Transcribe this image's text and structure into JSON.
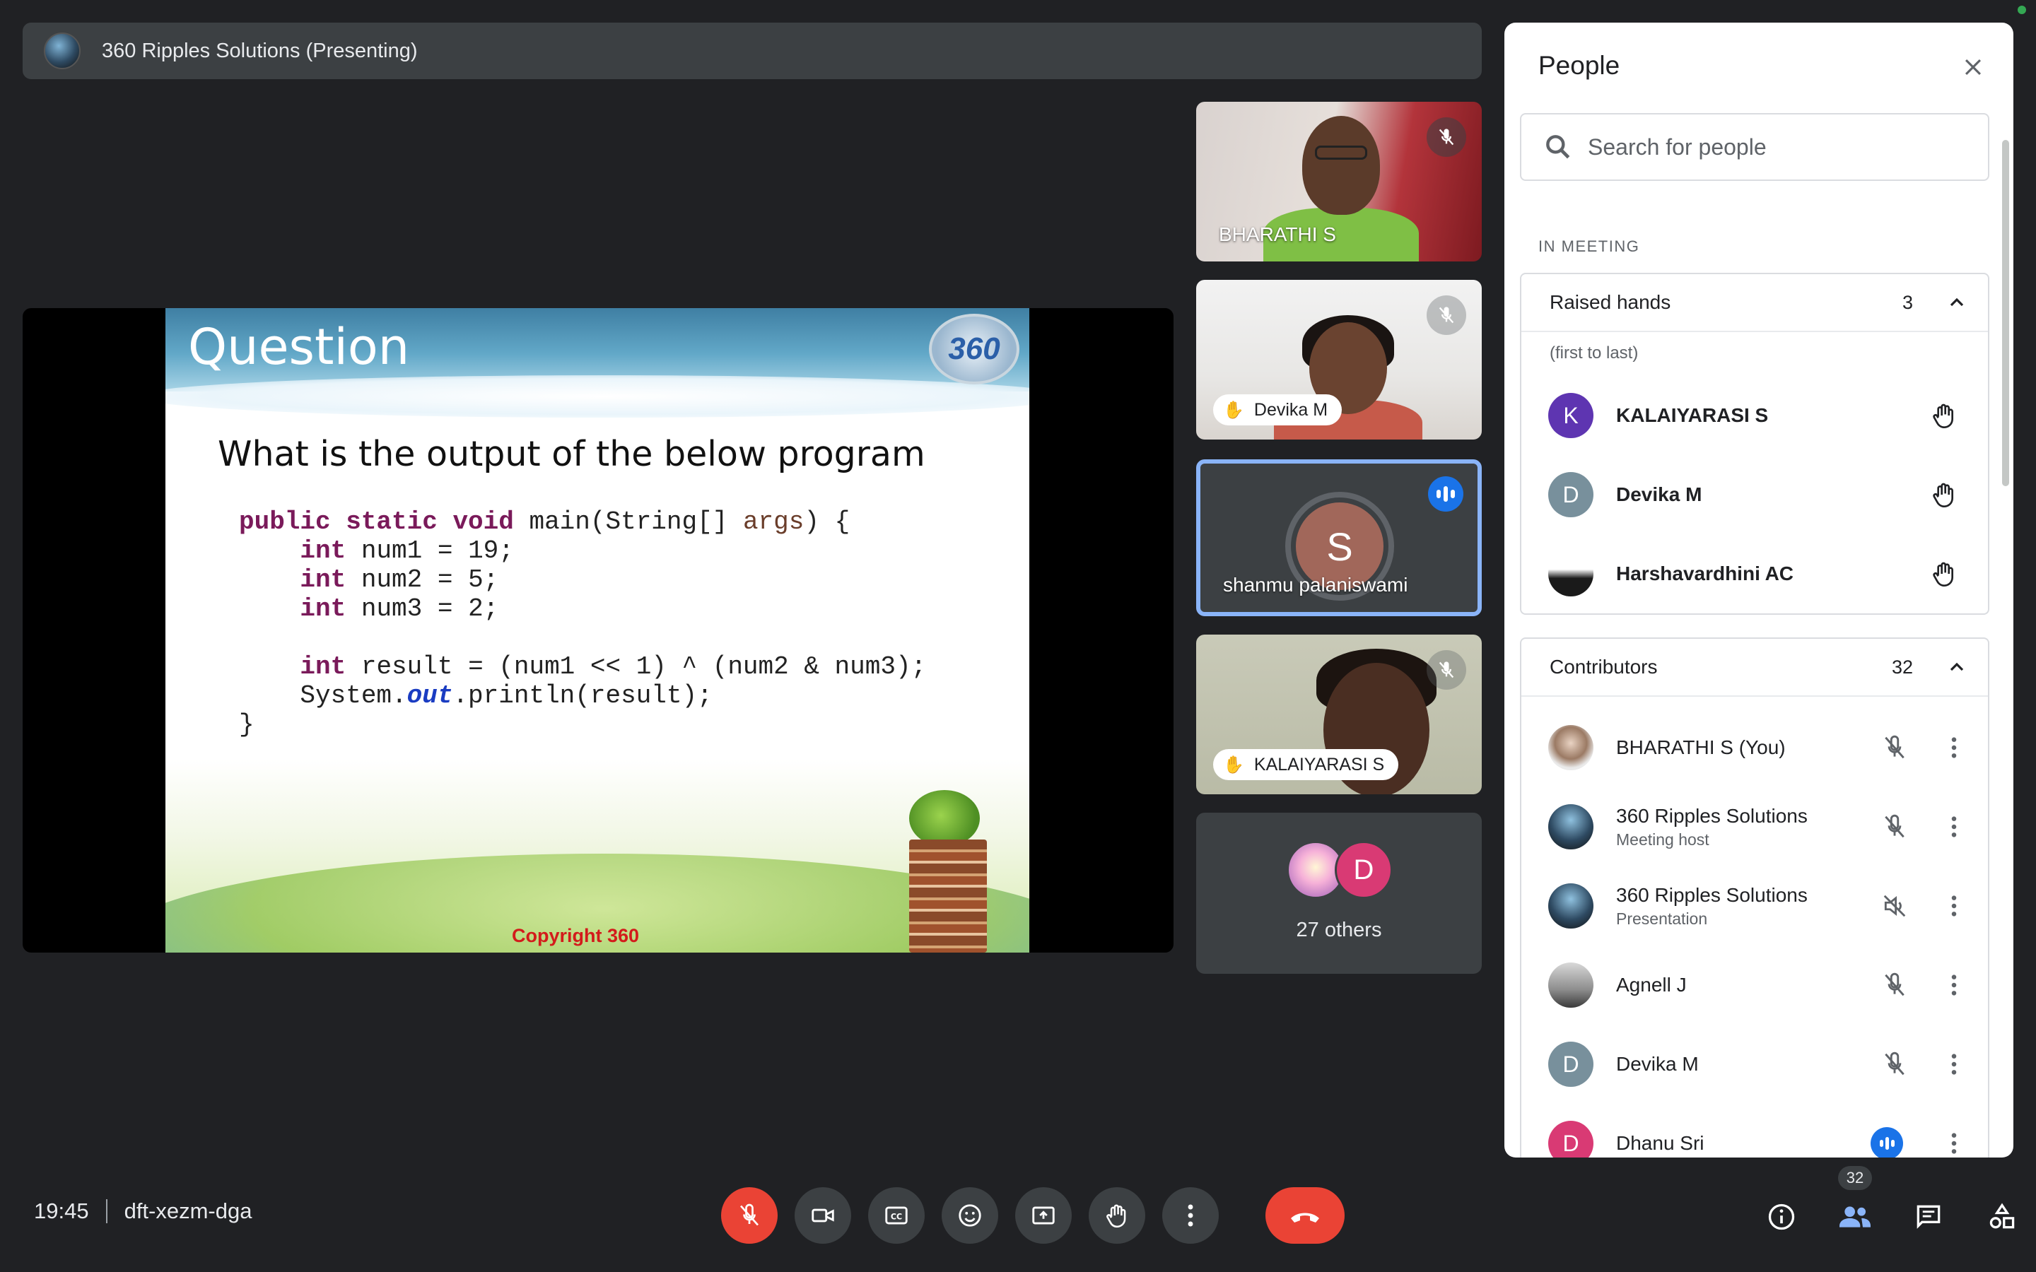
{
  "presenter": {
    "label": "360 Ripples Solutions (Presenting)"
  },
  "slide": {
    "title": "Question",
    "logo_text": "360",
    "question": "What is the output of the below program",
    "code_lines": [
      "public static void main(String[] args) {",
      "    int num1 = 19;",
      "    int num2 = 5;",
      "    int num3 = 2;",
      "",
      "    int result = (num1 << 1) ^ (num2 & num3);",
      "    System.out.println(result);",
      "}"
    ],
    "copyright": "Copyright 360"
  },
  "tiles": [
    {
      "name": "BHARATHI S",
      "muted": true
    },
    {
      "name": "Devika M",
      "hand_raised": true,
      "muted": true
    },
    {
      "name": "shanmu palaniswami",
      "initial": "S",
      "speaking": true
    },
    {
      "name": "KALAIYARASI S",
      "hand_raised": true,
      "muted": true
    },
    {
      "others_label": "27 others",
      "avatar_initial": "D"
    }
  ],
  "people_panel": {
    "title": "People",
    "search_placeholder": "Search for people",
    "section_label": "IN MEETING",
    "raised_hands": {
      "title": "Raised hands",
      "count": "3",
      "note": "(first to last)",
      "people": [
        {
          "initial": "K",
          "name": "KALAIYARASI S"
        },
        {
          "initial": "D",
          "name": "Devika M"
        },
        {
          "initial": "",
          "name": "Harshavardhini AC"
        }
      ]
    },
    "contributors": {
      "title": "Contributors",
      "count": "32",
      "people": [
        {
          "name": "BHARATHI S (You)",
          "sub": "",
          "status": "muted"
        },
        {
          "name": "360 Ripples Solutions",
          "sub": "Meeting host",
          "status": "muted"
        },
        {
          "name": "360 Ripples Solutions",
          "sub": "Presentation",
          "status": "audio-off"
        },
        {
          "name": "Agnell J",
          "sub": "",
          "status": "muted"
        },
        {
          "name": "Devika M",
          "initial": "D",
          "sub": "",
          "status": "muted"
        },
        {
          "name": "Dhanu Sri",
          "initial": "D",
          "sub": "",
          "status": "speaking"
        }
      ]
    }
  },
  "bottom_bar": {
    "time": "19:45",
    "meeting_code": "dft-xezm-dga",
    "participants_count": "32"
  },
  "colors": {
    "background": "#202124",
    "end_call": "#ea4335",
    "accent": "#1a73e8",
    "active_tile_border": "#8ab4f8"
  }
}
